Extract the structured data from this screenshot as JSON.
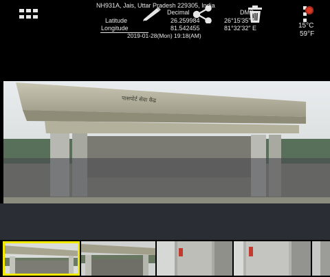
{
  "toolbar": {
    "icons": [
      "grid-icon",
      "pencil-icon",
      "share-icon",
      "trash-icon",
      "more-vert-icon"
    ]
  },
  "photo": {
    "building_sign": "पासपोर्ट सेवा केंद्र",
    "address": "NH931A, Jais, Uttar Pradesh 229305, India",
    "header_decimal": "Decimal",
    "header_dms": "DMS",
    "latitude_label": "Latitude",
    "latitude_decimal": "26.259984",
    "latitude_dms": "26°15'35\" N",
    "longitude_label": "Longitude",
    "longitude_decimal": "81.542455",
    "longitude_dms": "81°32'32\" E",
    "timestamp": "2019-01-28(Mon) 19:18(AM)",
    "temp_c": "15°C",
    "temp_f": "59°F"
  },
  "filmstrip": {
    "thumbnails": [
      "thumb-1",
      "thumb-2",
      "thumb-3",
      "thumb-4",
      "thumb-5"
    ],
    "selected_index": 0
  },
  "colors": {
    "accent_selected": "#f1e900",
    "weather_icon": "#d93a26"
  }
}
